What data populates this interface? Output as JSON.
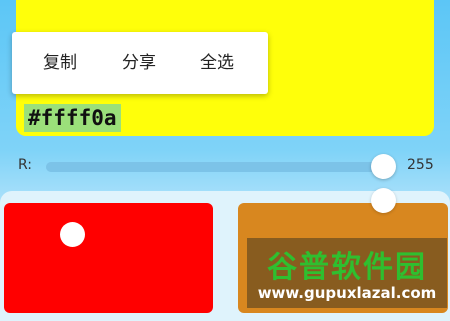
{
  "preview": {
    "hex": "#ffff0a"
  },
  "context_menu": {
    "items": [
      "复制",
      "分享",
      "全选"
    ]
  },
  "slider_r": {
    "label": "R:",
    "value": "255",
    "max": 255
  },
  "swatches": {
    "red_color": "#ff0000",
    "orange_color": "#d8871f"
  },
  "watermark": {
    "text_cn": "谷普软件园",
    "url": "www.gupuxlazal.com"
  }
}
